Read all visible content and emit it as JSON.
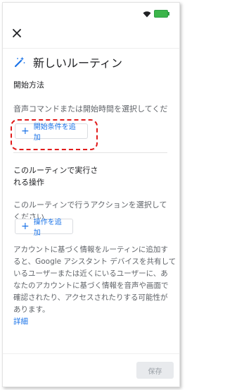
{
  "header": {
    "title": "新しいルーティン"
  },
  "start": {
    "heading": "開始方法",
    "description": "音声コマンドまたは開始時間を選択してくだ",
    "add_button": "開始条件を追加"
  },
  "actions": {
    "heading_line1": "このルーティンで実行さ",
    "heading_line2": "れる操作",
    "description_line1": "このルーティンで行うアクションを選択して",
    "description_line2": "ください",
    "add_button": "操作を追加"
  },
  "notice": {
    "line1": "アカウントに基づく情報をルーティンに追加す",
    "line2": "ると、Google アシスタント デバイスを共有して",
    "line3": "いるユーザーまたは近くにいるユーザーに、あ",
    "line4": "なたのアカウントに基づく情報を音声や画面で",
    "line5": "確認されたり、アクセスされたりする可能性が",
    "line6": "あります。",
    "link": "詳細"
  },
  "footer": {
    "save_label": "保存"
  },
  "colors": {
    "accent": "#1a73e8",
    "highlight": "#e11b1b"
  }
}
